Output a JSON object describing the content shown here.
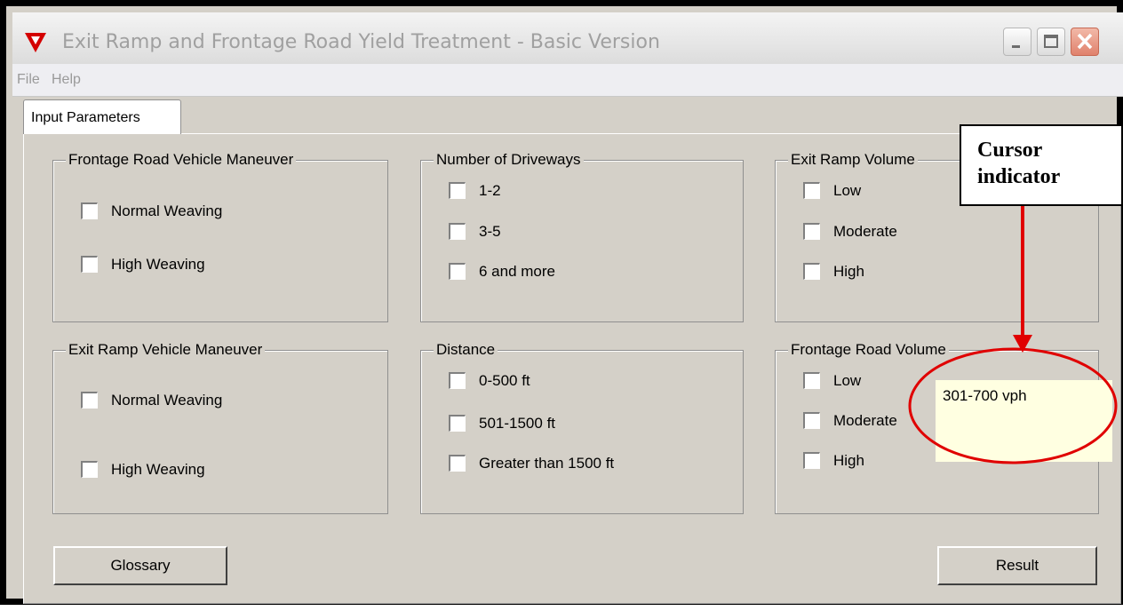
{
  "window": {
    "title": "Exit Ramp and Frontage Road Yield Treatment - Basic Version",
    "logo_icon": "red-triangle-logo",
    "controls": [
      "minimize-icon",
      "maximize-icon",
      "close-icon"
    ]
  },
  "menu": {
    "file": "File",
    "help": "Help"
  },
  "tabs": {
    "input_parameters": "Input Parameters"
  },
  "groups": {
    "frontage_maneuver": {
      "title": "Frontage Road Vehicle Maneuver",
      "options": [
        "Normal Weaving",
        "High Weaving"
      ]
    },
    "driveways": {
      "title": "Number of Driveways",
      "options": [
        "1-2",
        "3-5",
        "6 and more"
      ]
    },
    "exit_volume": {
      "title": "Exit Ramp Volume",
      "options": [
        "Low",
        "Moderate",
        "High"
      ]
    },
    "exit_maneuver": {
      "title": "Exit Ramp Vehicle Maneuver",
      "options": [
        "Normal Weaving",
        "High Weaving"
      ]
    },
    "distance": {
      "title": "Distance",
      "options": [
        "0-500 ft",
        "501-1500 ft",
        "Greater than 1500 ft"
      ]
    },
    "frontage_volume": {
      "title": "Frontage Road Volume",
      "options": [
        "Low",
        "Moderate",
        "High"
      ]
    }
  },
  "buttons": {
    "glossary": "Glossary",
    "result": "Result"
  },
  "tooltip": {
    "text": "301-700 vph"
  },
  "annotation": {
    "callout_text": "Cursor indicator",
    "color": "#e00000"
  },
  "colors": {
    "window_bg": "#d4d0c8",
    "tooltip_bg": "#ffffe1",
    "logo": "#d40000"
  }
}
